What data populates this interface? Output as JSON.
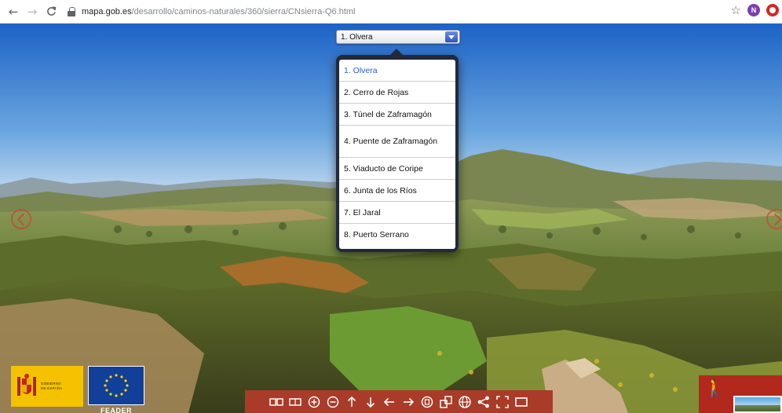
{
  "browser": {
    "url_host": "mapa.gob.es",
    "url_path": "/desarrollo/caminos-naturales/360/sierra/CNsierra-Q6.html",
    "profile_initial": "N",
    "back_icon": "arrow-left-icon",
    "forward_icon": "arrow-right-icon",
    "reload_icon": "reload-icon"
  },
  "location_select": {
    "selected": "1. Olvera",
    "options": [
      "1. Olvera",
      "2. Cerro de Rojas",
      "3. Túnel de Zaframagón",
      "4. Puente de Zaframagón",
      "5. Viaducto de Coripe",
      "6. Junta de los Ríos",
      "7. El Jaral",
      "8. Puerto Serrano"
    ]
  },
  "logos": {
    "spain_line1": "GOBIERNO",
    "spain_line2": "DE ESPAÑA",
    "eu_caption": "FEADER"
  },
  "toolbar": {
    "buttons": [
      "split-view-icon",
      "single-view-icon",
      "zoom-in-icon",
      "zoom-out-icon",
      "arrow-up-icon",
      "arrow-down-icon",
      "arrow-left-icon",
      "arrow-right-icon",
      "autorotate-icon",
      "floor-plan-icon",
      "vr-globe-icon",
      "share-icon",
      "fullscreen-icon",
      "hide-toolbar-icon"
    ],
    "color": "#a93b28"
  },
  "colors": {
    "sky_top": "#1d62c6",
    "sky_horizon": "#cfe1f1",
    "select_accent": "#2f55b8",
    "selected_option": "#2a5bd7",
    "popover_frame": "#23293a"
  }
}
